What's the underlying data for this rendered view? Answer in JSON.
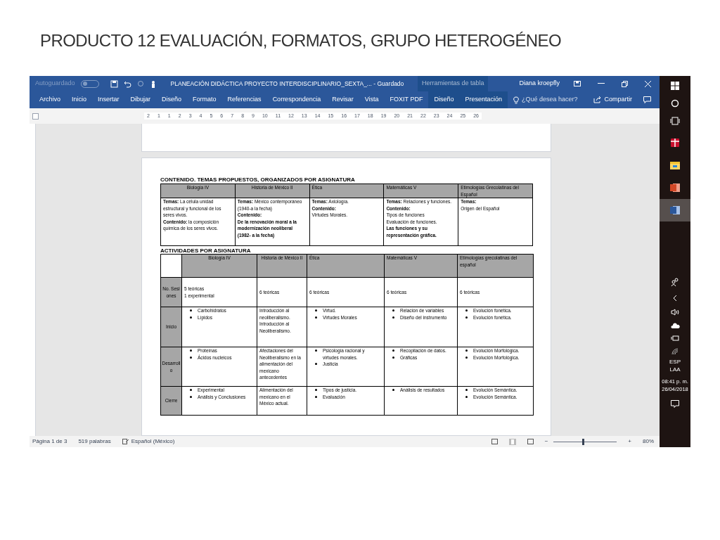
{
  "slide_title": "PRODUCTO 12 EVALUACIÓN, FORMATOS, GRUPO HETEROGÉNEO",
  "window": {
    "autosave_label": "Autoguardado",
    "autosave_on": false,
    "title": "PLANEACIÓN DIDÁCTICA PROYECTO INTERDISCIPLINARIO_SEXTA_...  -  Guardado",
    "context_label": "Herramientas de tabla",
    "user": "Diana kroepfly"
  },
  "tabs": [
    {
      "label": "Archivo",
      "selected": false,
      "contextual": false
    },
    {
      "label": "Inicio",
      "selected": false,
      "contextual": false
    },
    {
      "label": "Insertar",
      "selected": false,
      "contextual": false
    },
    {
      "label": "Dibujar",
      "selected": false,
      "contextual": false
    },
    {
      "label": "Diseño",
      "selected": false,
      "contextual": false
    },
    {
      "label": "Formato",
      "selected": false,
      "contextual": false
    },
    {
      "label": "Referencias",
      "selected": false,
      "contextual": false
    },
    {
      "label": "Correspondencia",
      "selected": false,
      "contextual": false
    },
    {
      "label": "Revisar",
      "selected": false,
      "contextual": false
    },
    {
      "label": "Vista",
      "selected": false,
      "contextual": false
    },
    {
      "label": "FOXIT PDF",
      "selected": false,
      "contextual": false
    },
    {
      "label": "Diseño",
      "selected": false,
      "contextual": true
    },
    {
      "label": "Presentación",
      "selected": false,
      "contextual": true
    }
  ],
  "tell_me": {
    "placeholder": "¿Qué desea hacer?"
  },
  "share_label": "Compartir",
  "ruler": [
    "2",
    "1",
    "1",
    "2",
    "3",
    "4",
    "5",
    "6",
    "7",
    "8",
    "9",
    "10",
    "11",
    "12",
    "13",
    "14",
    "15",
    "16",
    "17",
    "18",
    "19",
    "20",
    "21",
    "22",
    "23",
    "24",
    "25",
    "26"
  ],
  "document": {
    "content_heading": "CONTENIDO. TEMAS PROPUESTOS, ORGANIZADOS POR ASIGNATURA",
    "content_table": {
      "columns": [
        "Biología IV",
        "Historia de México II",
        "Ética",
        "Matemáticas V",
        "Etimologías Grecolatinas del Español"
      ],
      "cells": [
        [
          "**Temas:** La célula unidad estructural y funcional de los seres vivos.",
          "**Contenido:** la composición química de los seres vivos."
        ],
        [
          "**Temas:** México contemporáneo (1940-a la fecha)",
          "**Contenido:**",
          "**De la renovación moral a la modernización neoliberal (1982- a la fecha)**"
        ],
        [
          "**Temas:** Axiología.",
          "**Contenido:**",
          "Virtudes Morales."
        ],
        [
          "**Temas:** Relaciones y funciones.",
          "**Contenido:**",
          "Tipos de funciones",
          "Evaluación de funciones.",
          "**Las funciones y su representación gráfica.**"
        ],
        [
          "**Temas:**",
          "Origen del Español"
        ]
      ]
    },
    "activities_heading": "ACTIVIDADES POR ASIGNATURA",
    "activities_table": {
      "columns": [
        "Biología IV",
        "Historia de México II",
        "Ética",
        "Matemáticas V",
        "Etimologías grecolatinas del español"
      ],
      "rows": [
        {
          "label": "No. Sesiones",
          "cells": [
            {
              "kind": "text",
              "items": [
                "5 teóricas",
                "1 experimental"
              ]
            },
            {
              "kind": "text",
              "items": [
                "6 teóricas"
              ]
            },
            {
              "kind": "text",
              "items": [
                "6 teóricas"
              ]
            },
            {
              "kind": "text",
              "items": [
                "6 teóricas"
              ]
            },
            {
              "kind": "text",
              "items": [
                "6 teóricas"
              ]
            }
          ]
        },
        {
          "label": "Inicio",
          "cells": [
            {
              "kind": "bullets",
              "items": [
                "Carbohidratos",
                "Lípidos"
              ]
            },
            {
              "kind": "text",
              "items": [
                "Introducción al neoliberalismo.",
                "Introducción al Neoliberalismo."
              ]
            },
            {
              "kind": "bullets",
              "items": [
                "Virtud.",
                "Virtudes Morales"
              ]
            },
            {
              "kind": "bullets",
              "items": [
                "Relación de variables",
                "Diseño del instrumento"
              ]
            },
            {
              "kind": "bullets",
              "items": [
                "Evolución fonética.",
                "Evolución fonética."
              ]
            }
          ]
        },
        {
          "label": "Desarrollo",
          "cells": [
            {
              "kind": "bullets",
              "items": [
                "Proteínas",
                "Ácidos nucleicos"
              ]
            },
            {
              "kind": "text",
              "items": [
                "Afectaciones del Neoliberalismo en la alimentación del mexicano antecedentes"
              ]
            },
            {
              "kind": "bullets",
              "items": [
                "Psicología racional y virtudes morales.",
                "Justicia"
              ]
            },
            {
              "kind": "bullets",
              "items": [
                "Recopilación de datos.",
                "Gráficas"
              ]
            },
            {
              "kind": "bullets",
              "items": [
                "Evolución Morfológica.",
                "Evolución Morfológica."
              ]
            }
          ]
        },
        {
          "label": "Cierre",
          "cells": [
            {
              "kind": "bullets",
              "items": [
                "Experimental",
                "Análisis y Conclusiones"
              ]
            },
            {
              "kind": "text",
              "items": [
                "Alimentación del mexicano en el México actual."
              ]
            },
            {
              "kind": "bullets",
              "items": [
                "Tipos de justicia.",
                "Evaluación"
              ]
            },
            {
              "kind": "bullets",
              "items": [
                "Análisis de resultados"
              ]
            },
            {
              "kind": "bullets",
              "items": [
                "Evolución Semántica.",
                "Evolución Semántica."
              ]
            }
          ]
        }
      ]
    }
  },
  "status_bar": {
    "page": "Página 1 de 3",
    "words": "519 palabras",
    "language": "Español (México)",
    "zoom_out": "−",
    "zoom_slider": {
      "level": 0.45
    },
    "zoom_in": "+",
    "zoom": "80%"
  },
  "taskbar": {
    "apps": [
      {
        "kind": "gift",
        "active": false
      },
      {
        "kind": "folder",
        "active": false
      },
      {
        "kind": "powerpoint",
        "active": false
      },
      {
        "kind": "word",
        "active": true
      }
    ],
    "language": "ESP",
    "layout": "LAA",
    "time": "08:41 p. m.",
    "date": "26/04/2018"
  }
}
